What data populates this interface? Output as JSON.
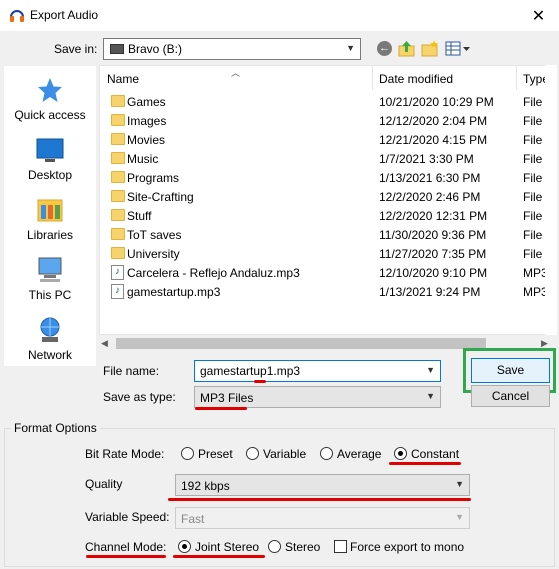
{
  "window": {
    "title": "Export Audio",
    "close_glyph": "✕"
  },
  "savein": {
    "label": "Save in:",
    "value": "Bravo (B:)"
  },
  "toolbar": {
    "back_glyph": "←"
  },
  "sidebar": {
    "items": [
      {
        "label": "Quick access",
        "icon": "quick-access-star-icon"
      },
      {
        "label": "Desktop",
        "icon": "desktop-icon"
      },
      {
        "label": "Libraries",
        "icon": "libraries-icon"
      },
      {
        "label": "This PC",
        "icon": "computer-icon"
      },
      {
        "label": "Network",
        "icon": "network-icon"
      }
    ]
  },
  "filelist": {
    "columns": {
      "name": "Name",
      "date": "Date modified",
      "type": "Type"
    },
    "rows": [
      {
        "name": "Games",
        "date": "10/21/2020 10:29 PM",
        "type": "File fo",
        "kind": "folder"
      },
      {
        "name": "Images",
        "date": "12/12/2020 2:04 PM",
        "type": "File fo",
        "kind": "folder"
      },
      {
        "name": "Movies",
        "date": "12/21/2020 4:15 PM",
        "type": "File fo",
        "kind": "folder"
      },
      {
        "name": "Music",
        "date": "1/7/2021 3:30 PM",
        "type": "File fo",
        "kind": "folder"
      },
      {
        "name": "Programs",
        "date": "1/13/2021 6:30 PM",
        "type": "File fo",
        "kind": "folder"
      },
      {
        "name": "Site-Crafting",
        "date": "12/2/2020 2:46 PM",
        "type": "File fo",
        "kind": "folder"
      },
      {
        "name": "Stuff",
        "date": "12/2/2020 12:31 PM",
        "type": "File fo",
        "kind": "folder"
      },
      {
        "name": "ToT saves",
        "date": "11/30/2020 9:36 PM",
        "type": "File fo",
        "kind": "folder"
      },
      {
        "name": "University",
        "date": "11/27/2020 7:35 PM",
        "type": "File fo",
        "kind": "folder"
      },
      {
        "name": "Carcelera - Reflejo Andaluz.mp3",
        "date": "12/10/2020 9:10 PM",
        "type": "MP3",
        "kind": "mp3"
      },
      {
        "name": "gamestartup.mp3",
        "date": "1/13/2021 9:24 PM",
        "type": "MP3",
        "kind": "mp3"
      }
    ]
  },
  "filename": {
    "label": "File name:",
    "value": "gamestartup1.mp3"
  },
  "filetype": {
    "label": "Save as type:",
    "value": "MP3 Files"
  },
  "buttons": {
    "save": "Save",
    "cancel": "Cancel"
  },
  "format": {
    "title": "Format Options",
    "bitrate_label": "Bit Rate Mode:",
    "bitrate_options": [
      "Preset",
      "Variable",
      "Average",
      "Constant"
    ],
    "bitrate_selected": "Constant",
    "quality_label": "Quality",
    "quality_value": "192 kbps",
    "speed_label": "Variable Speed:",
    "speed_value": "Fast",
    "channel_label": "Channel Mode:",
    "channel_options": [
      "Joint Stereo",
      "Stereo"
    ],
    "channel_selected": "Joint Stereo",
    "force_mono_label": "Force export to mono",
    "force_mono_checked": false
  },
  "colors": {
    "highlight_green": "#2fa84f",
    "annotation_red": "#e00000",
    "accent_blue": "#0078d7"
  }
}
